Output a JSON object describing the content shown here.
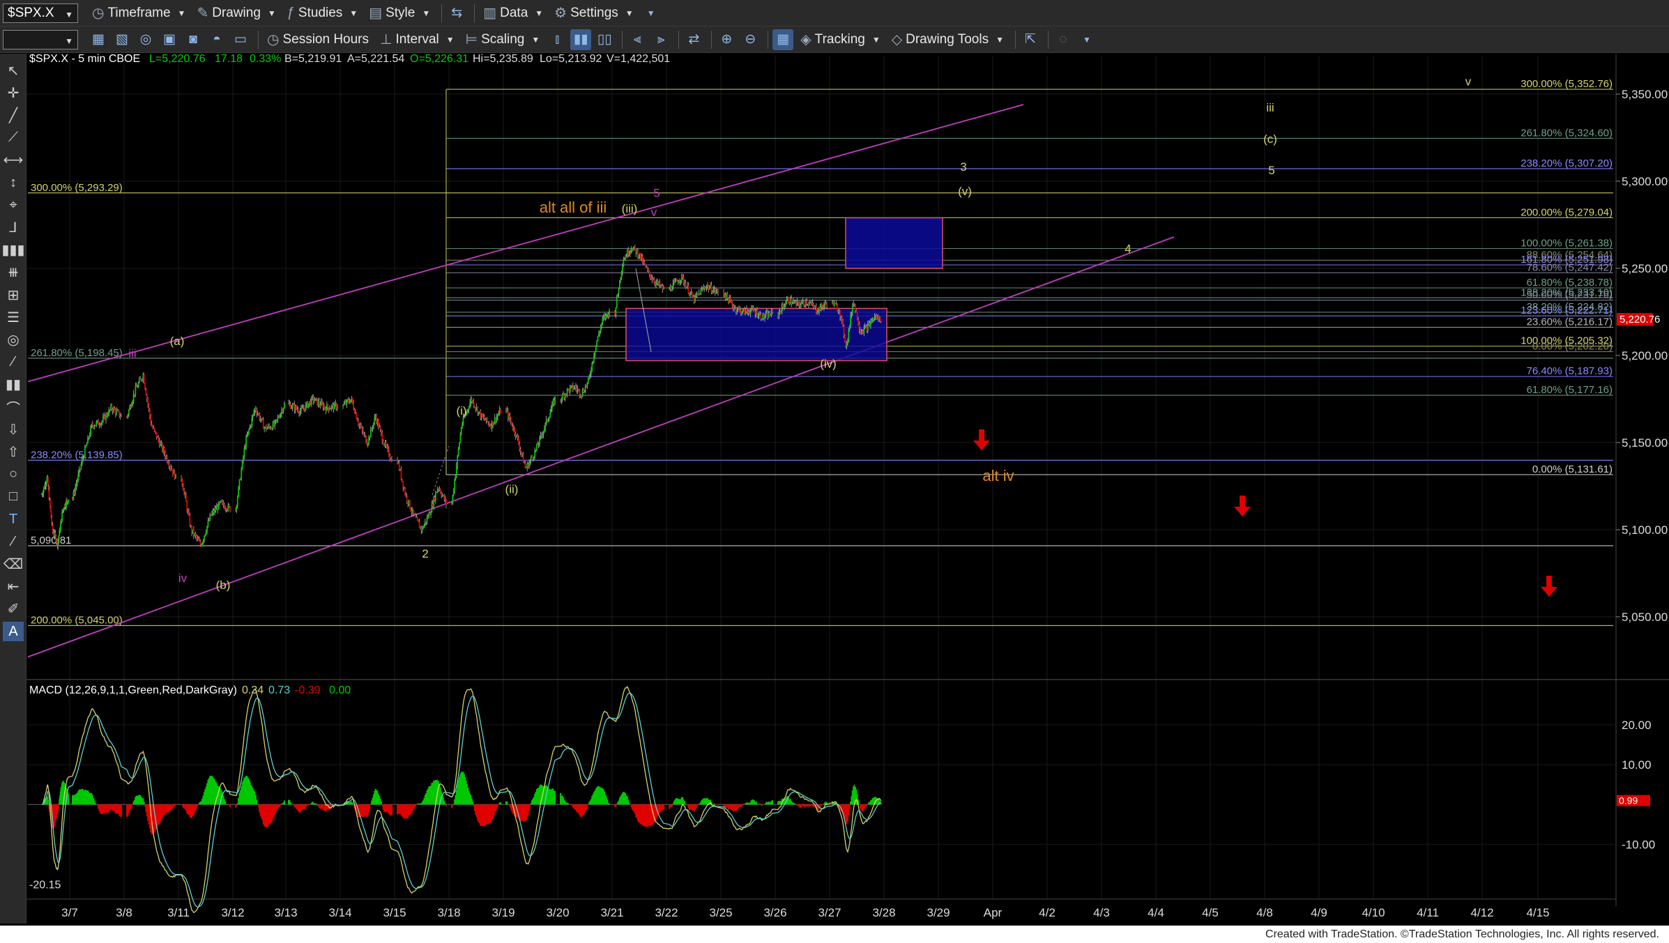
{
  "toolbar1": {
    "symbol": "$SPX.X",
    "timeframe": "Timeframe",
    "drawing": "Drawing",
    "studies": "Studies",
    "style": "Style",
    "data": "Data",
    "settings": "Settings"
  },
  "toolbar2": {
    "session_hours": "Session Hours",
    "interval": "Interval",
    "scaling": "Scaling",
    "tracking": "Tracking",
    "drawing_tools": "Drawing Tools"
  },
  "header": {
    "symbol_info": "$SPX.X - 5 min  CBOE",
    "last": "L=5,220.76",
    "chg": "17.18",
    "pct": "0.33%",
    "bid": "B=5,219.91",
    "ask": "A=5,221.54",
    "open": "O=5,226.31",
    "hi": "Hi=5,235.89",
    "lo": "Lo=5,213.92",
    "vol": "V=1,422,501"
  },
  "macd_header": {
    "label": "MACD (12,26,9,1,1,Green,Red,DarkGray)",
    "v1": "0.34",
    "v2": "0.73",
    "v3": "-0.39",
    "v4": "0.00"
  },
  "colors": {
    "up": "#00c800",
    "down": "#e00000",
    "yellow": "#d4d46a",
    "orange": "#e08a1e",
    "magenta": "#c040c0",
    "blue_box": "#0a0a9a",
    "grid": "#1a1a1a"
  },
  "footer": "Created with TradeStation. ©TradeStation Technologies, Inc. All rights reserved.",
  "chart_data": {
    "type": "candlestick",
    "symbol": "$SPX.X",
    "interval": "5 min",
    "ylim": [
      5018,
      5372
    ],
    "price_ticks": [
      "5,350.00",
      "5,300.00",
      "5,250.00",
      "5,200.00",
      "5,150.00",
      "5,100.00",
      "5,050.00"
    ],
    "price_tick_values": [
      5350,
      5300,
      5250,
      5200,
      5150,
      5100,
      5050
    ],
    "current_price_label": "5,220.76",
    "x_ticks": [
      "3/7",
      "3/8",
      "3/11",
      "3/12",
      "3/13",
      "3/14",
      "3/15",
      "3/18",
      "3/19",
      "3/20",
      "3/21",
      "3/22",
      "3/25",
      "3/26",
      "3/27",
      "3/28",
      "3/29",
      "Apr",
      "4/2",
      "4/3",
      "4/4",
      "4/5",
      "4/8",
      "4/9",
      "4/10",
      "4/11",
      "4/12",
      "4/15"
    ],
    "session_points": [
      {
        "d": "3/6",
        "p": [
          5120,
          5130,
          5100,
          5092,
          5112,
          5118
        ]
      },
      {
        "d": "3/7",
        "p": [
          5118,
          5140,
          5160,
          5162,
          5170,
          5165
        ]
      },
      {
        "d": "3/8",
        "p": [
          5165,
          5180,
          5189,
          5160,
          5150,
          5140,
          5130
        ]
      },
      {
        "d": "3/11",
        "p": [
          5130,
          5100,
          5091,
          5108,
          5115,
          5112
        ]
      },
      {
        "d": "3/12",
        "p": [
          5112,
          5150,
          5170,
          5158,
          5160,
          5172
        ]
      },
      {
        "d": "3/13",
        "p": [
          5172,
          5168,
          5175,
          5170,
          5171
        ]
      },
      {
        "d": "3/14",
        "p": [
          5171,
          5175,
          5160,
          5150,
          5165,
          5150,
          5140
        ]
      },
      {
        "d": "3/15",
        "p": [
          5140,
          5120,
          5108,
          5100,
          5110,
          5125,
          5115
        ]
      },
      {
        "d": "3/18",
        "p": [
          5115,
          5160,
          5175,
          5165,
          5160,
          5168
        ]
      },
      {
        "d": "3/19",
        "p": [
          5168,
          5155,
          5135,
          5145,
          5160,
          5175
        ]
      },
      {
        "d": "3/20",
        "p": [
          5175,
          5180,
          5182,
          5178,
          5185,
          5205,
          5220,
          5225
        ]
      },
      {
        "d": "3/21",
        "p": [
          5225,
          5255,
          5262,
          5258,
          5248,
          5242,
          5238
        ]
      },
      {
        "d": "3/22",
        "p": [
          5238,
          5245,
          5232,
          5240,
          5236
        ]
      },
      {
        "d": "3/25",
        "p": [
          5236,
          5228,
          5225,
          5226,
          5222,
          5224
        ]
      },
      {
        "d": "3/26",
        "p": [
          5224,
          5232,
          5229,
          5231,
          5226,
          5230
        ]
      },
      {
        "d": "3/27",
        "p": [
          5230,
          5226,
          5205,
          5232,
          5214,
          5216,
          5222,
          5220.76
        ]
      }
    ],
    "fib_levels_right": [
      {
        "label": "300.00% (5,352.76)",
        "value": 5352.76,
        "color": "#d4d46a"
      },
      {
        "label": "261.80% (5,324.60)",
        "value": 5324.6,
        "color": "#6fa08a"
      },
      {
        "label": "238.20% (5,307.20)",
        "value": 5307.2,
        "color": "#8a8aff"
      },
      {
        "label": "200.00% (5,279.04)",
        "value": 5279.04,
        "color": "#d4d46a"
      },
      {
        "label": "100.00% (5,261.38)",
        "value": 5261.38,
        "color": "#6fa08a"
      },
      {
        "label": "88.60% (5,254.64)",
        "value": 5254.64,
        "color": "#8a8a6a"
      },
      {
        "label": "161.80% (5,251.98)",
        "value": 5251.98,
        "color": "#8a8aff"
      },
      {
        "label": "78.60% (5,247.42)",
        "value": 5247.42,
        "color": "#8a8aaa"
      },
      {
        "label": "61.80% (5,238.78)",
        "value": 5238.78,
        "color": "#6fa08a"
      },
      {
        "label": "138.20% (5,233.10)",
        "value": 5233.1,
        "color": "#6fa08a"
      },
      {
        "label": "50.00% (5,231.76)",
        "value": 5231.76,
        "color": "#8a8aaa"
      },
      {
        "label": "38.20% (5,224.82)",
        "value": 5224.82,
        "color": "#6fa08a"
      },
      {
        "label": "123.60% (5,222.71)",
        "value": 5222.71,
        "color": "#8a8aff"
      },
      {
        "label": "23.60% (5,216.17)",
        "value": 5216.17,
        "color": "#b8b8b8"
      },
      {
        "label": "100.00% (5,205.32)",
        "value": 5205.32,
        "color": "#d4d46a"
      },
      {
        "label": "0.00% (5,202.20)",
        "value": 5202.2,
        "color": "#8a8a6a"
      },
      {
        "label": "76.40% (5,187.93)",
        "value": 5187.93,
        "color": "#8a8aff"
      },
      {
        "label": "61.80% (5,177.16)",
        "value": 5177.16,
        "color": "#6fa08a"
      },
      {
        "label": "0.00% (5,131.61)",
        "value": 5131.61,
        "color": "#d0d0d0"
      }
    ],
    "fib_levels_left": [
      {
        "label": "300.00% (5,293.29)",
        "value": 5293.29,
        "color": "#d4d46a"
      },
      {
        "label": "261.80% (5,198.45)",
        "value": 5198.45,
        "color": "#6fa08a"
      },
      {
        "label": "238.20% (5,139.85)",
        "value": 5139.85,
        "color": "#8a8aff"
      },
      {
        "label": "5,090.81",
        "value": 5090.81,
        "color": "#d0d0d0"
      },
      {
        "label": "200.00% (5,045.00)",
        "value": 5045.0,
        "color": "#d4d46a"
      }
    ],
    "wave_labels": [
      {
        "t": "(a)",
        "d": "3/11",
        "v": 5206,
        "c": "#d4d46a"
      },
      {
        "t": "iii",
        "d": "3/8",
        "v": 5199,
        "c": "#c040c0"
      },
      {
        "t": "iv",
        "d": "3/11",
        "v": 5070,
        "c": "#c040c0"
      },
      {
        "t": "(b)",
        "d": "3/11",
        "v": 5066,
        "c": "#d4d46a"
      },
      {
        "t": "2",
        "d": "3/15",
        "v": 5084,
        "c": "#d4d46a"
      },
      {
        "t": "(i)",
        "d": "3/18",
        "v": 5166,
        "c": "#d4d46a"
      },
      {
        "t": "(ii)",
        "d": "3/19",
        "v": 5121,
        "c": "#d4d46a"
      },
      {
        "t": "alt all of iii",
        "d": "3/20",
        "v": 5282,
        "c": "#e08a1e"
      },
      {
        "t": "(iii)",
        "d": "3/21",
        "v": 5282,
        "c": "#d4d46a"
      },
      {
        "t": "5",
        "d": "3/22",
        "v": 5291,
        "c": "#c040c0"
      },
      {
        "t": "v",
        "d": "3/22",
        "v": 5280,
        "c": "#c040c0"
      },
      {
        "t": "(iv)",
        "d": "3/27",
        "v": 5193,
        "c": "#d4d46a"
      },
      {
        "t": "3",
        "d": "3/29",
        "v": 5306,
        "c": "#d4d46a"
      },
      {
        "t": "(v)",
        "d": "3/29",
        "v": 5292,
        "c": "#d4d46a"
      },
      {
        "t": "4",
        "d": "4/4",
        "v": 5259,
        "c": "#d4d46a"
      },
      {
        "t": "alt iv",
        "d": "Apr",
        "v": 5128,
        "c": "#e08a1e"
      },
      {
        "t": "iii",
        "d": "4/8",
        "v": 5340,
        "c": "#d4d46a"
      },
      {
        "t": "(c)",
        "d": "4/8",
        "v": 5322,
        "c": "#d4d46a"
      },
      {
        "t": "5",
        "d": "4/8",
        "v": 5304,
        "c": "#d4d46a"
      },
      {
        "t": "v",
        "d": "4/12",
        "v": 5355,
        "c": "#d4d46a"
      }
    ],
    "macd": {
      "ylim": [
        -22,
        27
      ],
      "ticks": [
        "20.00",
        "10.00",
        "-10.00"
      ],
      "tick_values": [
        20,
        10,
        -10
      ],
      "low_label": "-20.15",
      "current": "0.99"
    }
  }
}
